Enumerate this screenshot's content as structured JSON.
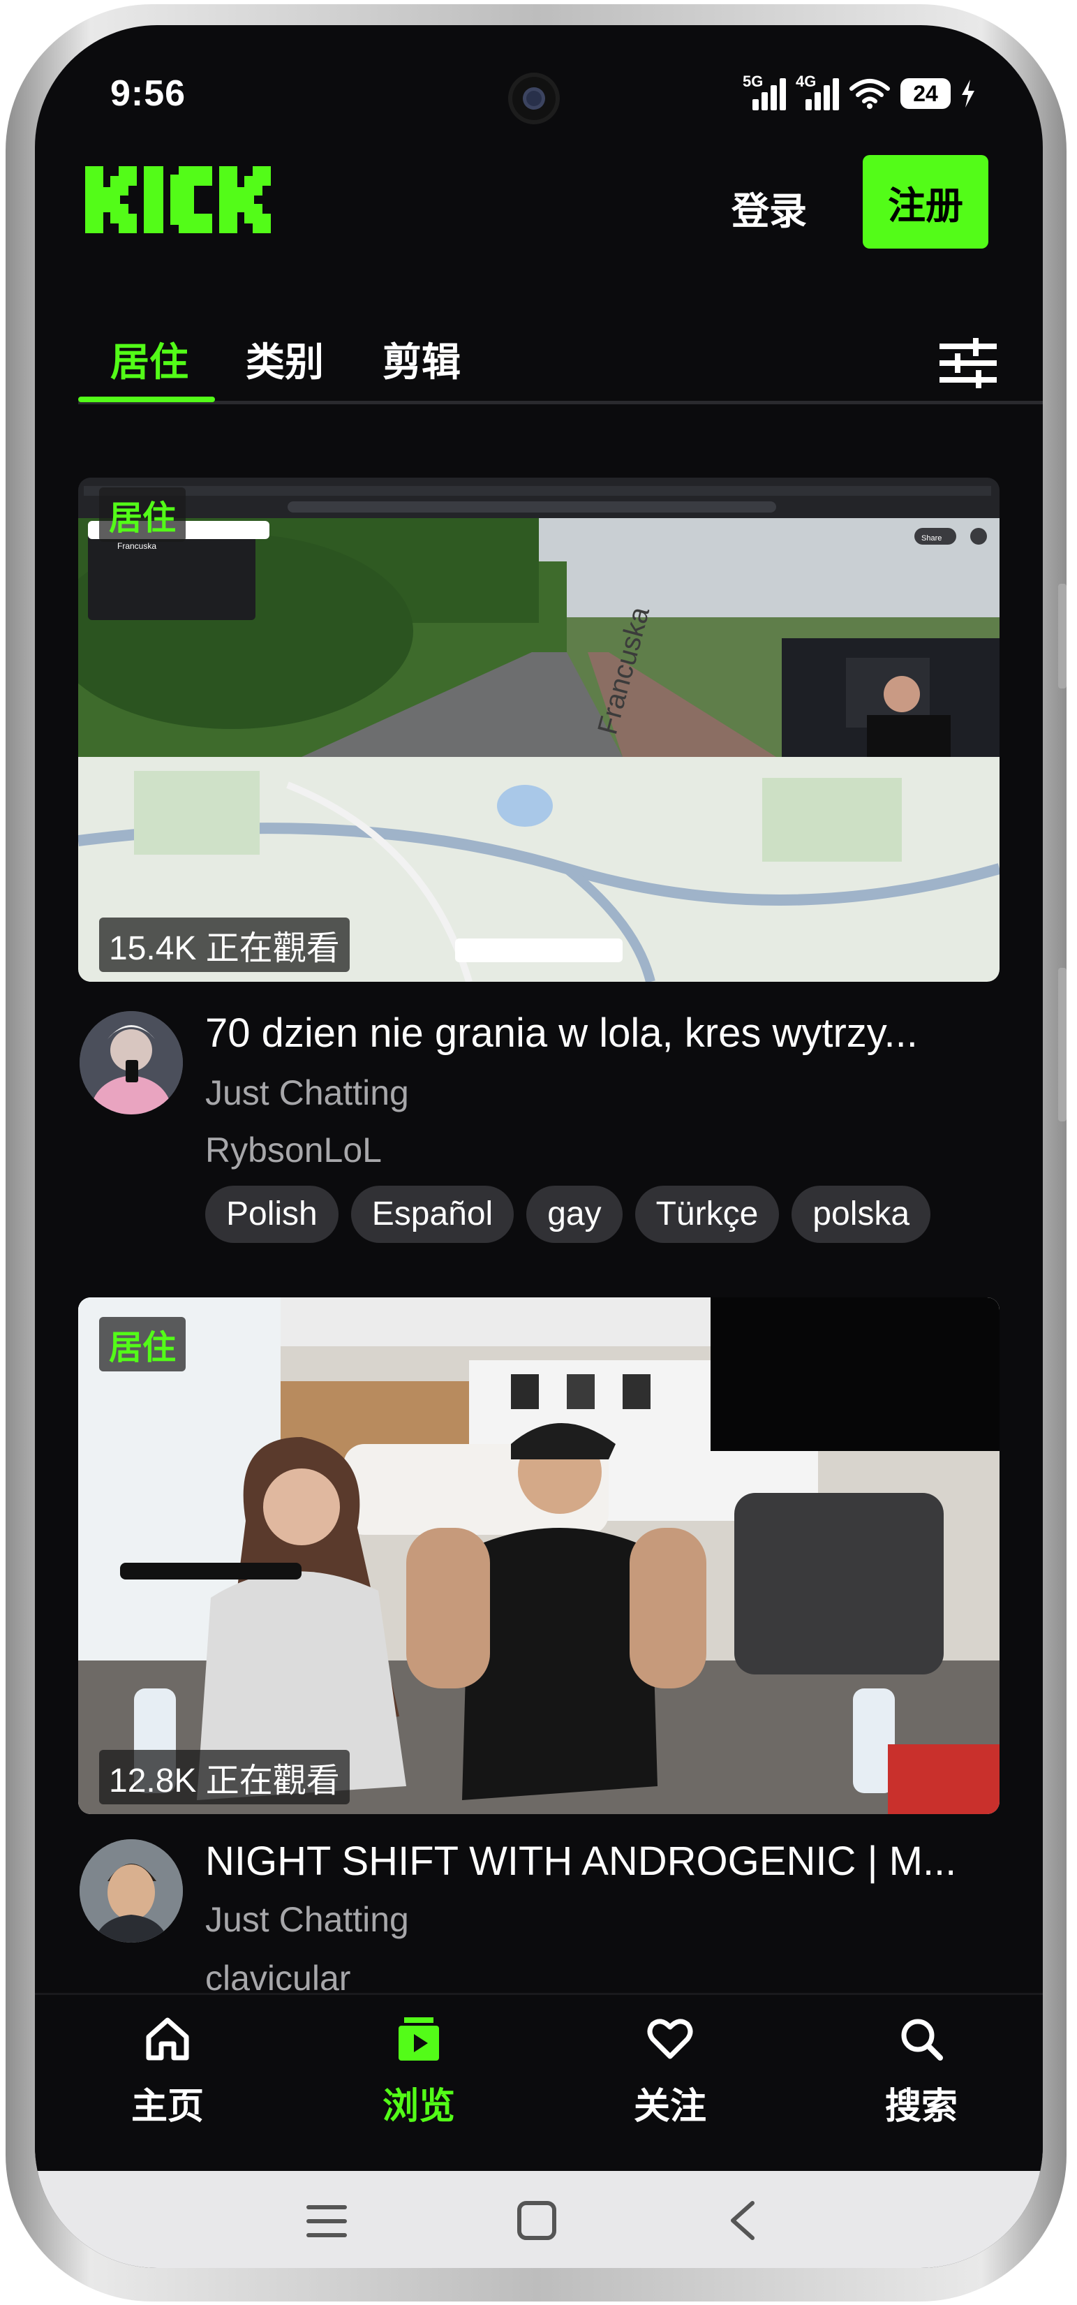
{
  "status_bar": {
    "time": "9:56",
    "network_1": "5G",
    "network_2": "4G",
    "battery": "24"
  },
  "header": {
    "logo_text": "KICK",
    "login_label": "登录",
    "register_label": "注册",
    "accent_color": "#53fc18"
  },
  "tabs": [
    {
      "label": "居住",
      "active": true
    },
    {
      "label": "类别",
      "active": false
    },
    {
      "label": "剪辑",
      "active": false
    }
  ],
  "streams": [
    {
      "live_badge": "居住",
      "viewers": "15.4K 正在觀看",
      "title": "70 dzien nie grania w lola, kres wytrzy...",
      "category": "Just Chatting",
      "streamer": "RybsonLoL",
      "tags": [
        "Polish",
        "Español",
        "gay",
        "Türkçe",
        "polska"
      ],
      "thumbnail_texts": {
        "place": "Francuska",
        "street": "Francuska",
        "share": "Share"
      }
    },
    {
      "live_badge": "居住",
      "viewers": "12.8K 正在觀看",
      "title": "NIGHT SHIFT WITH ANDROGENIC | M...",
      "category": "Just Chatting",
      "streamer": "clavicular"
    }
  ],
  "bottom_nav": [
    {
      "label": "主页",
      "icon": "home-icon",
      "active": false
    },
    {
      "label": "浏览",
      "icon": "browse-icon",
      "active": true
    },
    {
      "label": "关注",
      "icon": "heart-icon",
      "active": false
    },
    {
      "label": "搜索",
      "icon": "search-icon",
      "active": false
    }
  ]
}
